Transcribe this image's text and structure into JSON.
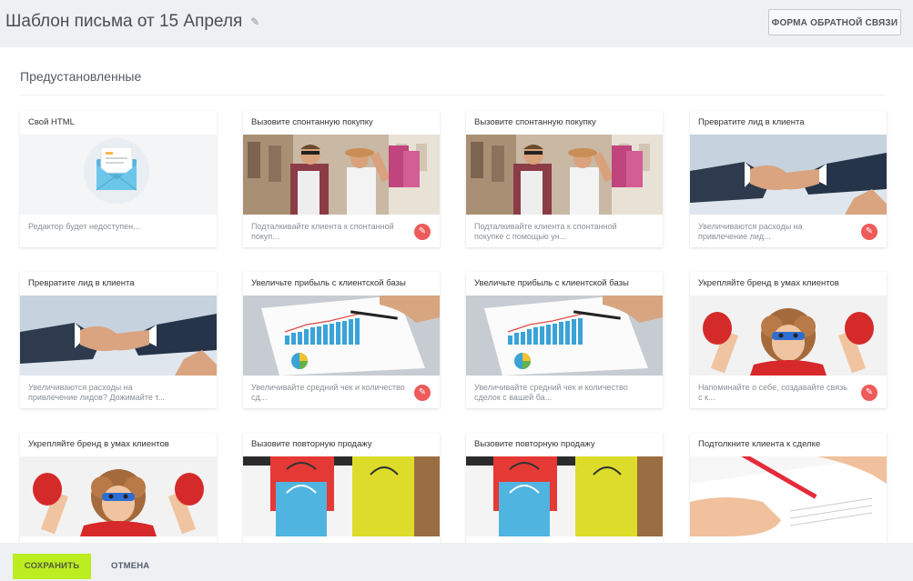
{
  "header": {
    "title": "Шаблон письма от 15 Апреля",
    "edit_icon": "pencil-icon",
    "feedback_label": "ФОРМА ОБРАТНОЙ СВЯЗИ"
  },
  "section": {
    "title": "Предустановленные"
  },
  "cards": [
    {
      "title": "Свой HTML",
      "desc": "Редактор будет недоступен...",
      "image": "envelope",
      "editable": false
    },
    {
      "title": "Вызовите спонтанную покупку",
      "desc": "Подталкивайте клиента к спонтанной покуп...",
      "image": "shopping-couple",
      "editable": true
    },
    {
      "title": "Вызовите спонтанную покупку",
      "desc": "Подталкивайте клиента к спонтанной покупке с помощью ун...",
      "image": "shopping-couple",
      "editable": false
    },
    {
      "title": "Превратите лид в клиента",
      "desc": "Увеличиваются расходы на привлечение лид...",
      "image": "handshake",
      "editable": true
    },
    {
      "title": "Превратите лид в клиента",
      "desc": "Увеличиваются расходы на привлечение лидов? Дожимайте т...",
      "image": "handshake",
      "editable": false
    },
    {
      "title": "Увеличьте прибыль с клиентской базы",
      "desc": "Увеличивайте средний чек и количество сд...",
      "image": "chart-paper",
      "editable": true
    },
    {
      "title": "Увеличьте прибыль с клиентской базы",
      "desc": "Увеличивайте средний чек и количество сделок с вашей ба...",
      "image": "chart-paper",
      "editable": false
    },
    {
      "title": "Укрепляйте бренд в умах клиентов",
      "desc": "Напоминайте о себе, создавайте связь с к...",
      "image": "superhero-kid",
      "editable": true
    },
    {
      "title": "Укрепляйте бренд в умах клиентов",
      "desc": "",
      "image": "superhero-kid",
      "editable": false
    },
    {
      "title": "Вызовите повторную продажу",
      "desc": "",
      "image": "shopping-bags",
      "editable": false
    },
    {
      "title": "Вызовите повторную продажу",
      "desc": "",
      "image": "shopping-bags",
      "editable": false
    },
    {
      "title": "Подтолкните клиента к сделке",
      "desc": "",
      "image": "signing-document",
      "editable": false
    }
  ],
  "footer": {
    "save_label": "СОХРАНИТЬ",
    "cancel_label": "ОТМЕНА"
  },
  "colors": {
    "accent_green": "#bbed21",
    "pencil_red": "#ef5a5a"
  }
}
